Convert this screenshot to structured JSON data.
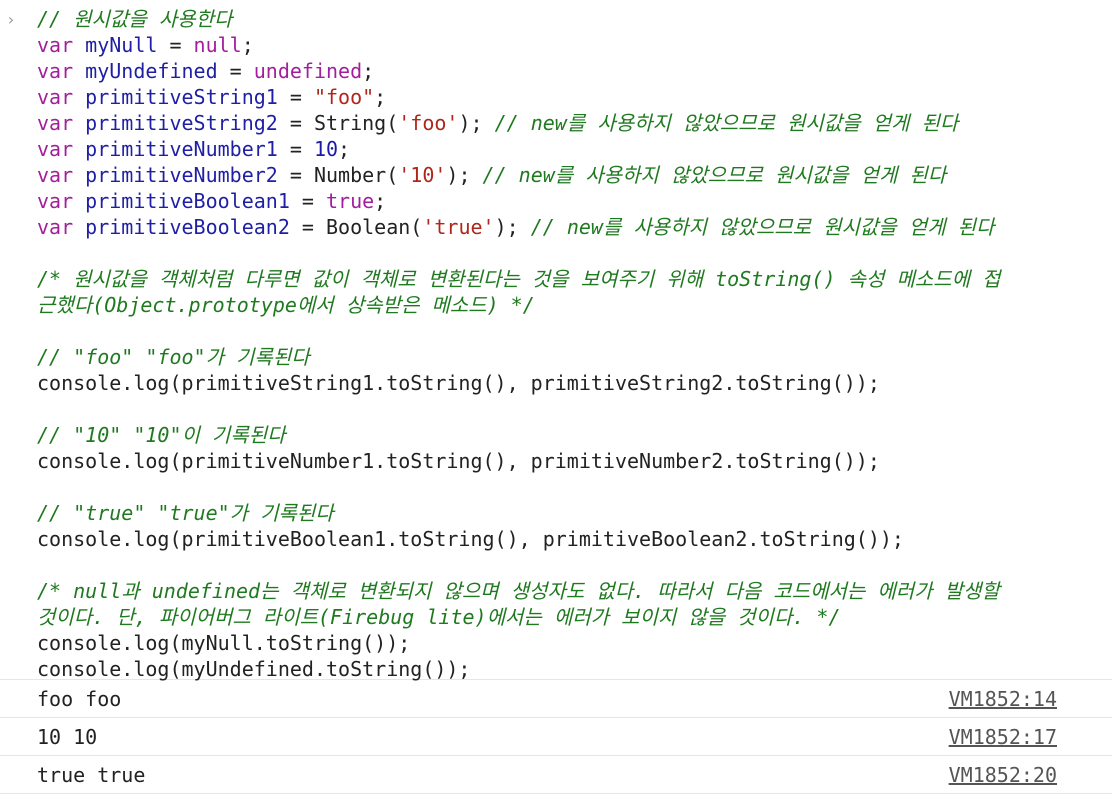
{
  "prompt_icon": "chevron-right-icon",
  "prompt_glyph": "›",
  "colors": {
    "keyword": "#a31e9c",
    "variable": "#1f1fa6",
    "string": "#b1261a",
    "number": "#1a1aa6",
    "comment": "#1f7a1f",
    "source_link": "#555555"
  },
  "code": [
    [
      {
        "t": "cmt",
        "v": "// 원시값을 사용한다"
      }
    ],
    [
      {
        "t": "kw",
        "v": "var "
      },
      {
        "t": "var",
        "v": "myNull"
      },
      {
        "t": "op",
        "v": " = "
      },
      {
        "t": "null",
        "v": "null"
      },
      {
        "t": "op",
        "v": ";"
      }
    ],
    [
      {
        "t": "kw",
        "v": "var "
      },
      {
        "t": "var",
        "v": "myUndefined"
      },
      {
        "t": "op",
        "v": " = "
      },
      {
        "t": "null",
        "v": "undefined"
      },
      {
        "t": "op",
        "v": ";"
      }
    ],
    [
      {
        "t": "kw",
        "v": "var "
      },
      {
        "t": "var",
        "v": "primitiveString1"
      },
      {
        "t": "op",
        "v": " = "
      },
      {
        "t": "str",
        "v": "\"foo\""
      },
      {
        "t": "op",
        "v": ";"
      }
    ],
    [
      {
        "t": "kw",
        "v": "var "
      },
      {
        "t": "var",
        "v": "primitiveString2"
      },
      {
        "t": "op",
        "v": " = "
      },
      {
        "t": "plain",
        "v": "String("
      },
      {
        "t": "str",
        "v": "'foo'"
      },
      {
        "t": "plain",
        "v": "); "
      },
      {
        "t": "cmt",
        "v": "// new를 사용하지 않았으므로 원시값을 얻게 된다"
      }
    ],
    [
      {
        "t": "kw",
        "v": "var "
      },
      {
        "t": "var",
        "v": "primitiveNumber1"
      },
      {
        "t": "op",
        "v": " = "
      },
      {
        "t": "num",
        "v": "10"
      },
      {
        "t": "op",
        "v": ";"
      }
    ],
    [
      {
        "t": "kw",
        "v": "var "
      },
      {
        "t": "var",
        "v": "primitiveNumber2"
      },
      {
        "t": "op",
        "v": " = "
      },
      {
        "t": "plain",
        "v": "Number("
      },
      {
        "t": "str",
        "v": "'10'"
      },
      {
        "t": "plain",
        "v": "); "
      },
      {
        "t": "cmt",
        "v": "// new를 사용하지 않았으므로 원시값을 얻게 된다"
      }
    ],
    [
      {
        "t": "kw",
        "v": "var "
      },
      {
        "t": "var",
        "v": "primitiveBoolean1"
      },
      {
        "t": "op",
        "v": " = "
      },
      {
        "t": "null",
        "v": "true"
      },
      {
        "t": "op",
        "v": ";"
      }
    ],
    [
      {
        "t": "kw",
        "v": "var "
      },
      {
        "t": "var",
        "v": "primitiveBoolean2"
      },
      {
        "t": "op",
        "v": " = "
      },
      {
        "t": "plain",
        "v": "Boolean("
      },
      {
        "t": "str",
        "v": "'true'"
      },
      {
        "t": "plain",
        "v": "); "
      },
      {
        "t": "cmt",
        "v": "// new를 사용하지 않았으므로 원시값을 얻게 된다"
      }
    ],
    [],
    [
      {
        "t": "cmt",
        "v": "/* 원시값을 객체처럼 다루면 값이 객체로 변환된다는 것을 보여주기 위해 toString() 속성 메소드에 접"
      }
    ],
    [
      {
        "t": "cmt",
        "v": "근했다(Object.prototype에서 상속받은 메소드) */"
      }
    ],
    [],
    [
      {
        "t": "cmt",
        "v": "// \"foo\" \"foo\"가 기록된다"
      }
    ],
    [
      {
        "t": "plain",
        "v": "console.log(primitiveString1.toString(), primitiveString2.toString());"
      }
    ],
    [],
    [
      {
        "t": "cmt",
        "v": "// \"10\" \"10\"이 기록된다"
      }
    ],
    [
      {
        "t": "plain",
        "v": "console.log(primitiveNumber1.toString(), primitiveNumber2.toString());"
      }
    ],
    [],
    [
      {
        "t": "cmt",
        "v": "// \"true\" \"true\"가 기록된다"
      }
    ],
    [
      {
        "t": "plain",
        "v": "console.log(primitiveBoolean1.toString(), primitiveBoolean2.toString());"
      }
    ],
    [],
    [
      {
        "t": "cmt",
        "v": "/* null과 undefined는 객체로 변환되지 않으며 생성자도 없다. 따라서 다음 코드에서는 에러가 발생할"
      }
    ],
    [
      {
        "t": "cmt",
        "v": "것이다. 단, 파이어버그 라이트(Firebug lite)에서는 에러가 보이지 않을 것이다. */"
      }
    ],
    [
      {
        "t": "plain",
        "v": "console.log(myNull.toString());"
      }
    ],
    [
      {
        "t": "plain",
        "v": "console.log(myUndefined.toString());"
      }
    ]
  ],
  "output": [
    {
      "text": "foo foo",
      "source": "VM1852:14"
    },
    {
      "text": "10 10",
      "source": "VM1852:17"
    },
    {
      "text": "true true",
      "source": "VM1852:20"
    }
  ]
}
